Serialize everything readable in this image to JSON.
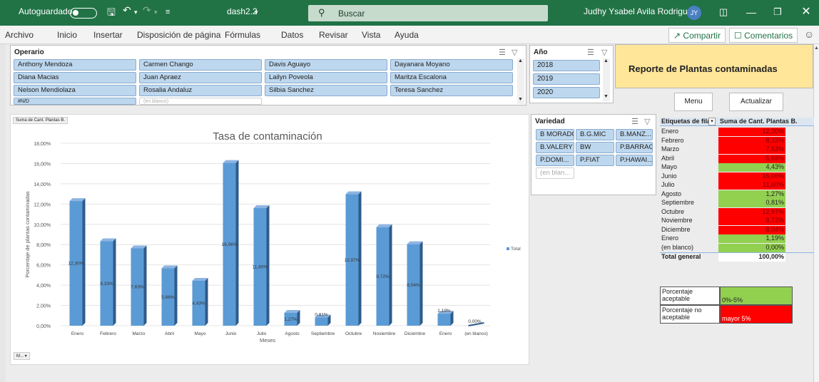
{
  "titlebar": {
    "autosave": "Autoguardado",
    "filename": "dash2.2",
    "search": "Buscar",
    "user": "Judhy Ysabel Avila Rodriguez",
    "initials": "JY"
  },
  "ribbon": {
    "tabs": [
      "Archivo",
      "Inicio",
      "Insertar",
      "Disposición de página",
      "Fórmulas",
      "Datos",
      "Revisar",
      "Vista",
      "Ayuda"
    ],
    "share": "Compartir",
    "comments": "Comentarios"
  },
  "operario": {
    "title": "Operario",
    "items": [
      "Anthony Mendoza",
      "Carmen Chango",
      "Davis Aguayo",
      "Dayanara Moyano",
      "Diana Macias",
      "Juan Apraez",
      "Lailyn Poveola",
      "Maritza Escalona",
      "Nelson Mendiolaza",
      "Rosalia Andaluz",
      "Silbia Sanchez",
      "Teresa Sanchez",
      "#N/D",
      "(en blanco)"
    ]
  },
  "anio": {
    "title": "Año",
    "items": [
      "2018",
      "2019",
      "2020"
    ]
  },
  "report_title": "Reporte de Plantas contaminadas",
  "buttons": {
    "menu": "Menu",
    "actualizar": "Actualizar"
  },
  "variedad": {
    "title": "Variedad",
    "items": [
      "B MORADO",
      "B.G.MIC",
      "B.MANZ...",
      "B.VALERY",
      "BW",
      "P.BARRAG",
      "P.DOMI...",
      "P.FIAT",
      "P.HAWAI...",
      "(en blan..."
    ]
  },
  "chart_tag": "Suma de Cant. Plantas B.",
  "field_button": "M...",
  "chart_data": {
    "type": "bar",
    "title": "Tasa de contaminación",
    "xlabel": "Meses",
    "ylabel": "Porcentaje de plantas contaminadas",
    "categories": [
      "Enero",
      "Febrero",
      "Marzo",
      "Abril",
      "Mayo",
      "Junio",
      "Julio",
      "Agosto",
      "Septiembre",
      "Octubre",
      "Noviembre",
      "Diciembre",
      "Enero",
      "(en blanco)"
    ],
    "series": [
      {
        "name": "Total",
        "values": [
          12.3,
          8.33,
          7.63,
          5.66,
          4.43,
          16.06,
          11.6,
          1.27,
          0.81,
          12.97,
          9.72,
          8.04,
          1.19,
          0.0
        ],
        "labels": [
          "12,30%",
          "8,33%",
          "7,63%",
          "5,66%",
          "4,43%",
          "16,06%",
          "11,60%",
          "1,27%",
          "0,81%",
          "12,97%",
          "9,72%",
          "8,04%",
          "1,19%",
          "0,00%"
        ]
      }
    ],
    "yticks": [
      "0,00%",
      "2,00%",
      "4,00%",
      "6,00%",
      "8,00%",
      "10,00%",
      "12,00%",
      "14,00%",
      "16,00%",
      "18,00%"
    ],
    "ylim": [
      0,
      18
    ],
    "legend_position": "right",
    "grid": true,
    "bar_color": "#5b9bd5"
  },
  "pivot": {
    "header_label": "Etiquetas de fila",
    "header_value": "Suma de Cant. Plantas B.",
    "rows": [
      {
        "label": "Enero",
        "value": "12,30%",
        "status": "bad"
      },
      {
        "label": "Febrero",
        "value": "8,33%",
        "status": "bad"
      },
      {
        "label": "Marzo",
        "value": "7,63%",
        "status": "bad"
      },
      {
        "label": "Abril",
        "value": "5,68%",
        "status": "bad"
      },
      {
        "label": "Mayo",
        "value": "4,43%",
        "status": "good"
      },
      {
        "label": "Junio",
        "value": "16,06%",
        "status": "bad"
      },
      {
        "label": "Julio",
        "value": "11,60%",
        "status": "bad"
      },
      {
        "label": "Agosto",
        "value": "1,27%",
        "status": "good"
      },
      {
        "label": "Septiembre",
        "value": "0,81%",
        "status": "good"
      },
      {
        "label": "Octubre",
        "value": "12,97%",
        "status": "bad"
      },
      {
        "label": "Noviembre",
        "value": "9,72%",
        "status": "bad"
      },
      {
        "label": "Diciembre",
        "value": "8,04%",
        "status": "bad"
      },
      {
        "label": "Enero",
        "value": "1,19%",
        "status": "good"
      },
      {
        "label": "(en blanco)",
        "value": "0,00%",
        "status": "good"
      }
    ],
    "total_label": "Total general",
    "total_value": "100,00%",
    "colors": {
      "good": "#92d050",
      "bad": "#ff0000"
    }
  },
  "legend_table": {
    "acceptable_label": "Porcentaje aceptable",
    "acceptable_range": "0%-5%",
    "not_acceptable_label": "Porcentaje no aceptable",
    "not_acceptable_range": "mayor 5%"
  }
}
